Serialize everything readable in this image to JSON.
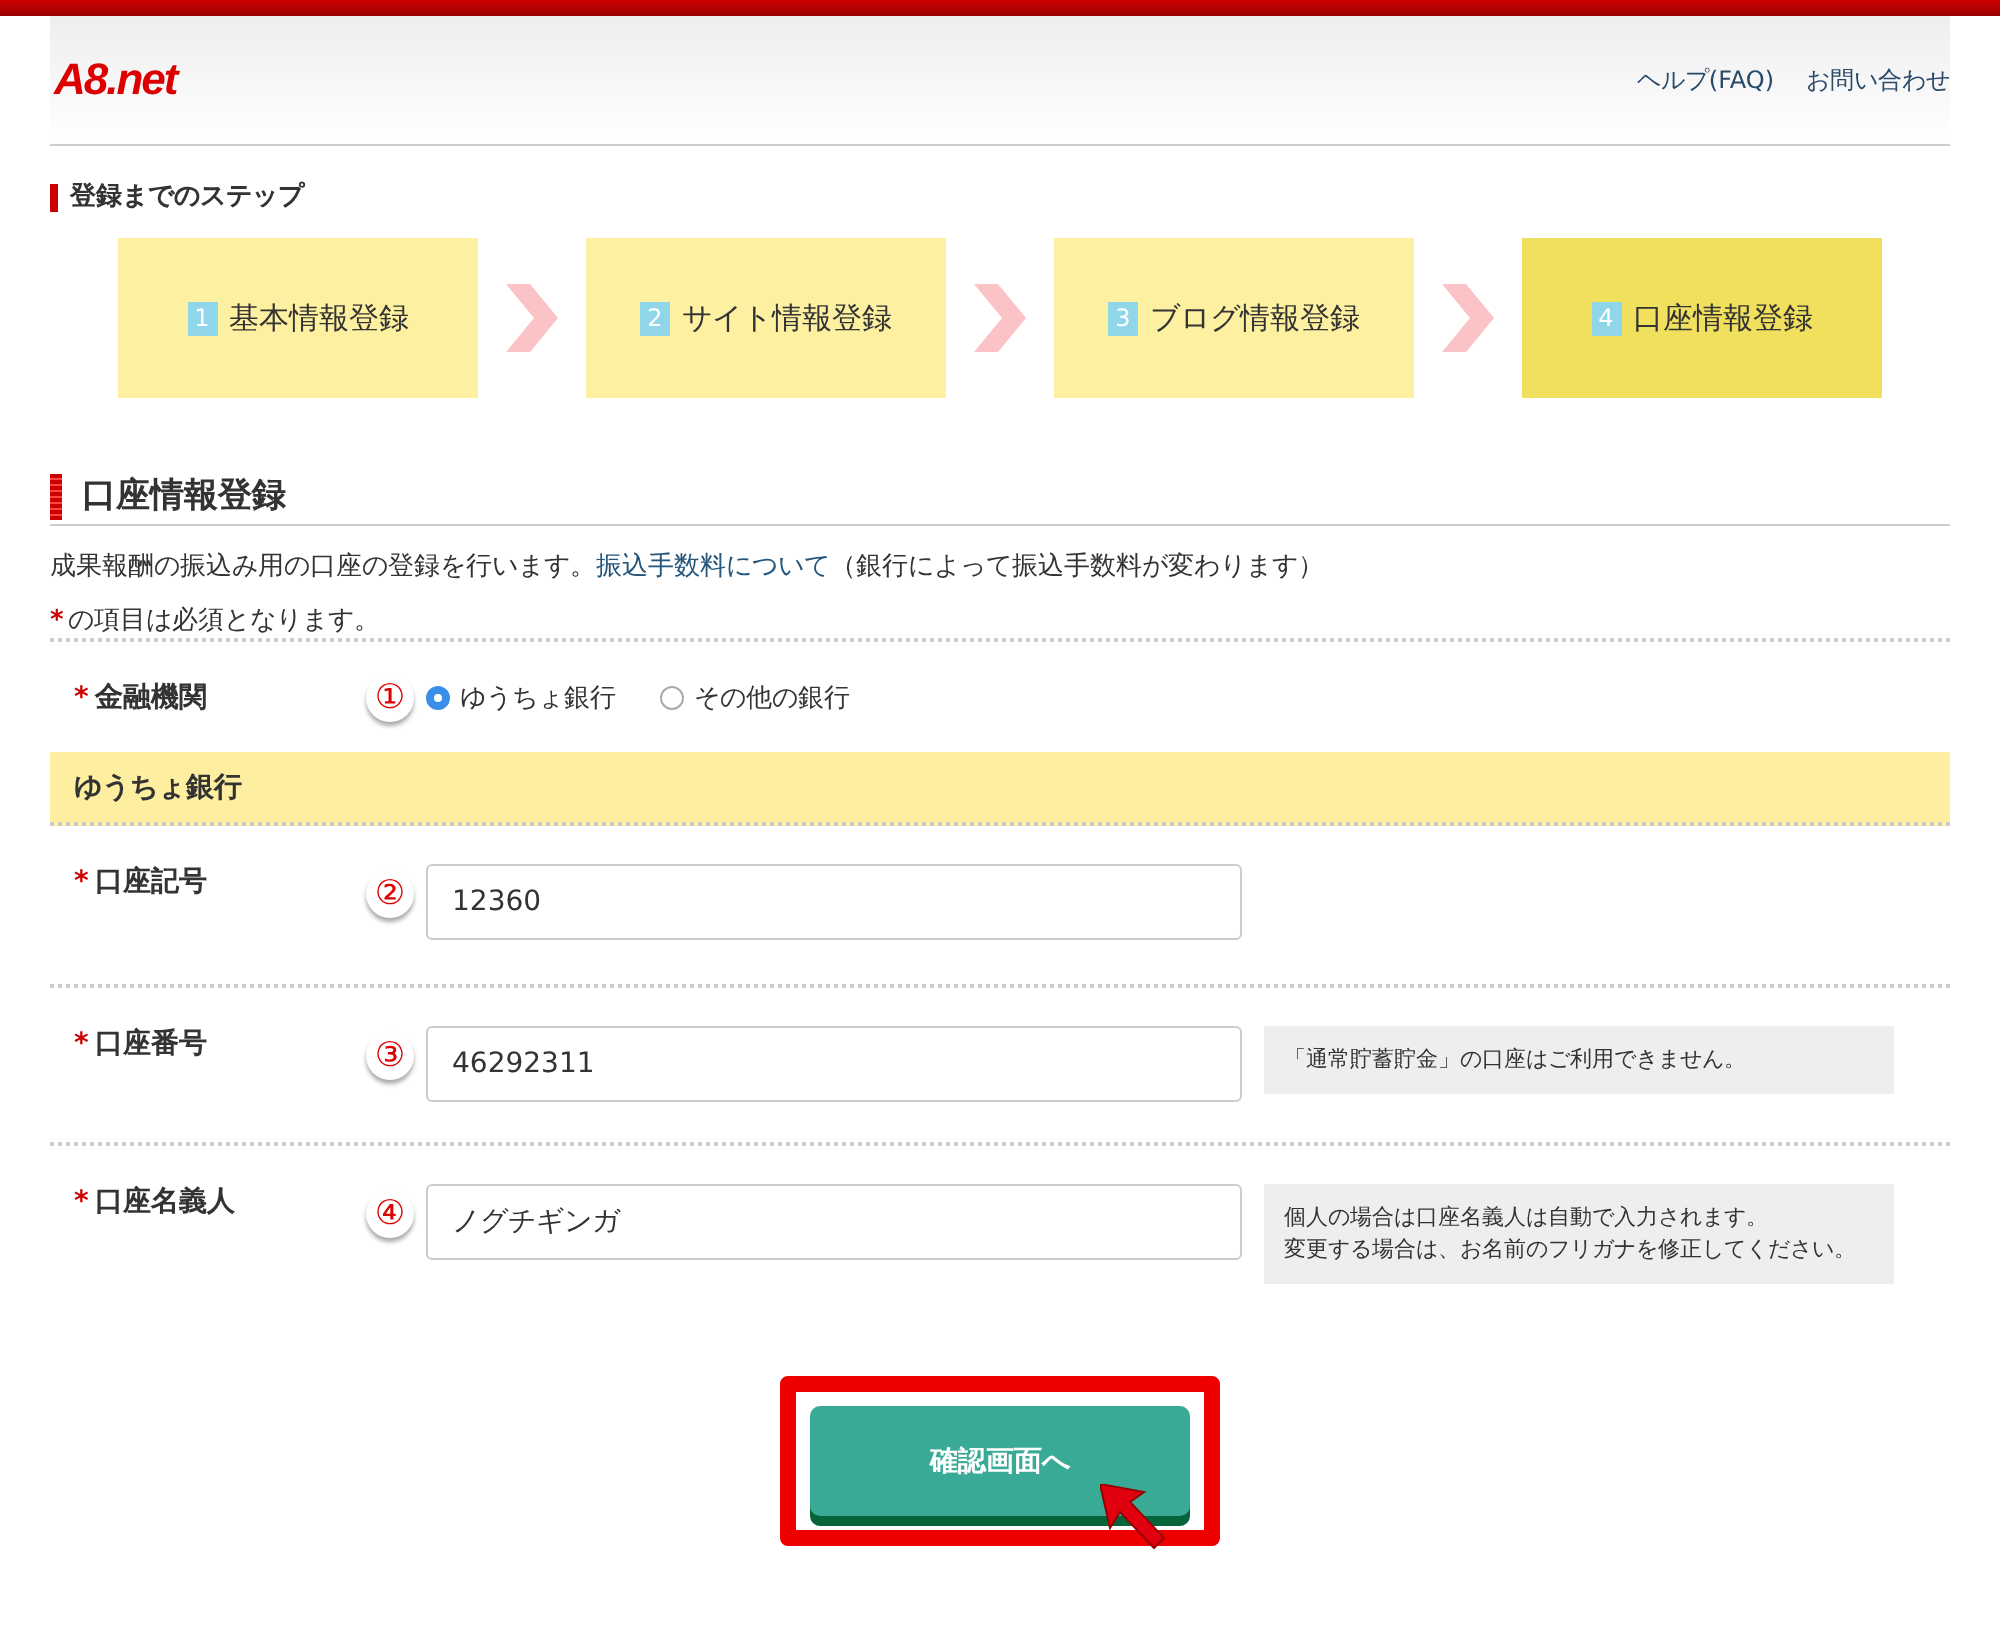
{
  "header": {
    "logo": "A8.net",
    "links": [
      "ヘルプ(FAQ)",
      "お問い合わせ"
    ]
  },
  "steps_title": "登録までのステップ",
  "steps": [
    {
      "number": "1",
      "label": "基本情報登録",
      "selected": false
    },
    {
      "number": "2",
      "label": "サイト情報登録",
      "selected": false
    },
    {
      "number": "3",
      "label": "ブログ情報登録",
      "selected": false
    },
    {
      "number": "4",
      "label": "口座情報登録",
      "selected": true
    }
  ],
  "section_title": "口座情報登録",
  "description": "成果報酬の振込み用の口座の登録を行います。",
  "fee_link": "振込手数料について",
  "fee_note": "（銀行によって振込手数料が変わります）",
  "required_mark": "*",
  "required_note": "の項目は必須となります。",
  "bank_field": {
    "label": "金融機関",
    "marker": "①",
    "options": [
      {
        "label": "ゆうちょ銀行",
        "selected": true
      },
      {
        "label": "その他の銀行",
        "selected": false
      }
    ]
  },
  "band_title": "ゆうちょ銀行",
  "fields": [
    {
      "label": "口座記号",
      "marker": "②",
      "value": "12360"
    },
    {
      "label": "口座番号",
      "marker": "③",
      "value": "46292311",
      "note": "「通常貯蓄貯金」の口座はご利用できません。"
    },
    {
      "label": "口座名義人",
      "marker": "④",
      "value": "ノグチギンガ",
      "note_lines": [
        "個人の場合は口座名義人は自動で入力されます。",
        "変更する場合は、お名前のフリガナを修正してください。"
      ]
    }
  ],
  "submit_button": "確認画面へ"
}
